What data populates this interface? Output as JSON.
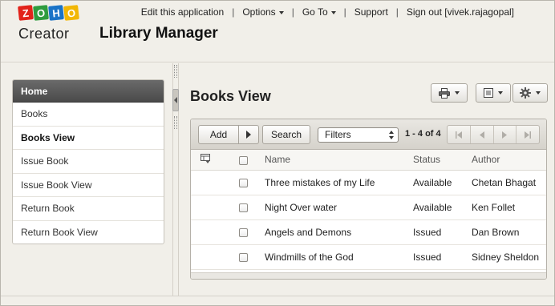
{
  "logo": {
    "letters": [
      "Z",
      "O",
      "H",
      "O"
    ],
    "letter_colors": [
      "#e2231a",
      "#2f9c3e",
      "#1a73c7",
      "#f2b705"
    ],
    "product": "Creator"
  },
  "app_title": "Library Manager",
  "topnav": {
    "edit": "Edit this application",
    "options": "Options",
    "goto": "Go To",
    "support": "Support",
    "signout": "Sign out [vivek.rajagopal]",
    "separator": "|"
  },
  "sidebar": {
    "items": [
      {
        "label": "Home"
      },
      {
        "label": "Books"
      },
      {
        "label": "Books View"
      },
      {
        "label": "Issue Book"
      },
      {
        "label": "Issue Book View"
      },
      {
        "label": "Return Book"
      },
      {
        "label": "Return Book View"
      }
    ]
  },
  "view": {
    "title": "Books View",
    "toolbar_icons": [
      "printer-icon",
      "list-icon",
      "gear-icon"
    ]
  },
  "grid_toolbar": {
    "add_label": "Add",
    "search_label": "Search",
    "filters_label": "Filters",
    "pager_text": "1 - 4 of 4"
  },
  "table": {
    "columns": [
      "Name",
      "Status",
      "Author"
    ],
    "rows": [
      {
        "name": "Three mistakes of my Life",
        "status": "Available",
        "author": "Chetan Bhagat"
      },
      {
        "name": "Night Over water",
        "status": "Available",
        "author": "Ken Follet"
      },
      {
        "name": "Angels and Demons",
        "status": "Issued",
        "author": "Dan Brown"
      },
      {
        "name": "Windmills of the God",
        "status": "Issued",
        "author": "Sidney Sheldon"
      }
    ]
  }
}
